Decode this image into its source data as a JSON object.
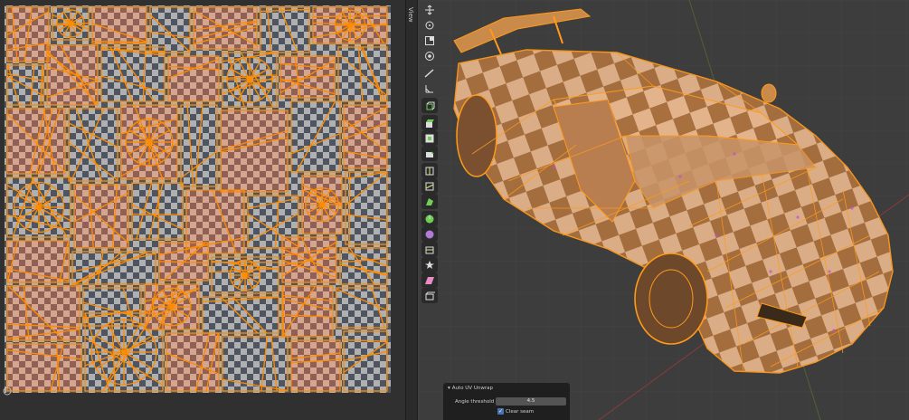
{
  "uv_editor": {
    "view_tab_label": "View"
  },
  "toolbar": {
    "tools": [
      {
        "icon": "move-icon"
      },
      {
        "icon": "rotate-icon"
      },
      {
        "icon": "scale-icon"
      },
      {
        "icon": "transform-icon"
      },
      {
        "icon": "annotate-icon"
      },
      {
        "icon": "measure-icon"
      },
      {
        "icon": "add-cube-icon"
      },
      {
        "icon": "extrude-region-icon"
      },
      {
        "icon": "inset-faces-icon"
      },
      {
        "icon": "bevel-icon"
      },
      {
        "icon": "loop-cut-icon"
      },
      {
        "icon": "knife-icon"
      },
      {
        "icon": "poly-build-icon"
      },
      {
        "icon": "spin-icon"
      },
      {
        "icon": "smooth-icon"
      },
      {
        "icon": "edge-slide-icon"
      },
      {
        "icon": "shrink-fatten-icon"
      },
      {
        "icon": "shear-icon"
      },
      {
        "icon": "rip-region-icon"
      }
    ]
  },
  "operator_panel": {
    "title": "Auto UV Unwrap",
    "angle_label": "Angle threshold",
    "angle_value": "4.5",
    "clear_seam_label": "Clear seam",
    "clear_seam_checked": true
  },
  "colors": {
    "uv_edge": "#ff8c00",
    "checker_light": "#b0b0b0",
    "checker_dark": "#555a66",
    "face_fill": "#e39a72",
    "viewport_bg": "#3d3d3d",
    "accent": "#4772b3"
  }
}
